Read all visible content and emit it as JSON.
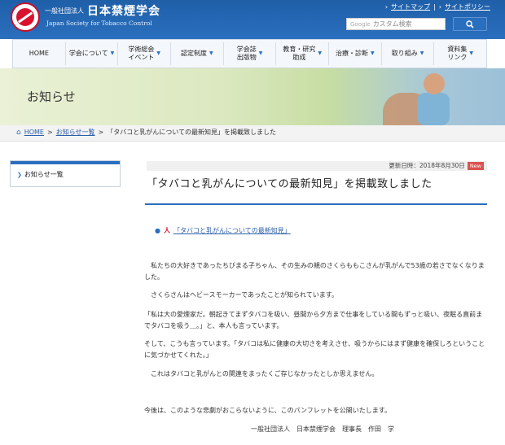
{
  "header": {
    "org_prefix": "一般社団法人",
    "org_name": "日本禁煙学会",
    "org_english": "Japan Society for Tobacco Control",
    "sitemap": "サイトマップ",
    "separator": "|",
    "policy": "サイトポリシー",
    "search_placeholder": "カスタム検索",
    "search_brand": "Google"
  },
  "nav": {
    "items": [
      {
        "label": "HOME"
      },
      {
        "label": "学会について"
      },
      {
        "label": "学術総会\nイベント"
      },
      {
        "label": "認定制度"
      },
      {
        "label": "学会誌\n出版物"
      },
      {
        "label": "教育・研究\n助成"
      },
      {
        "label": "治療・診断"
      },
      {
        "label": "取り組み"
      },
      {
        "label": "資料集\nリンク"
      }
    ]
  },
  "banner": {
    "title": "お知らせ"
  },
  "breadcrumb": {
    "home": "HOME",
    "sep": ">",
    "list": "お知らせ一覧",
    "current": "「タバコと乳がんについての最新知見」を掲載致しました"
  },
  "sidebar": {
    "item": "お知らせ一覧"
  },
  "article": {
    "updated": "更新日時：2018年8月30日",
    "new_badge": "New",
    "title": "「タバコと乳がんについての最新知見」を掲載致しました",
    "pdf_link": "「タバコと乳がんについての最新知見」",
    "paragraphs": [
      "私たちの大好きであったちびまる子ちゃん、その生みの親のさくらももこさんが乳がんで53歳の若さでなくなりました。",
      "さくらさんはヘビースモーカーであったことが知られています。",
      "「私は大の愛煙家だ。朝起きてまずタバコを吸い、昼間から夕方まで仕事をしている間もずっと吸い、夜眠る直前までタバコを吸う＿。」と、本人も言っています。",
      "そして、こうも言っています。「タバコは私に健康の大切さを考えさせ、吸うからにはまず健康を確保しろということに気づかせてくれた。」",
      "これはタバコと乳がんとの関連をまったくご存じなかったとしか思えません。",
      "今後は、このような悲劇がおこらないように、このパンフレットを公開いたします。",
      "一般社団法人　日本禁煙学会　理事長　作田　学"
    ]
  }
}
